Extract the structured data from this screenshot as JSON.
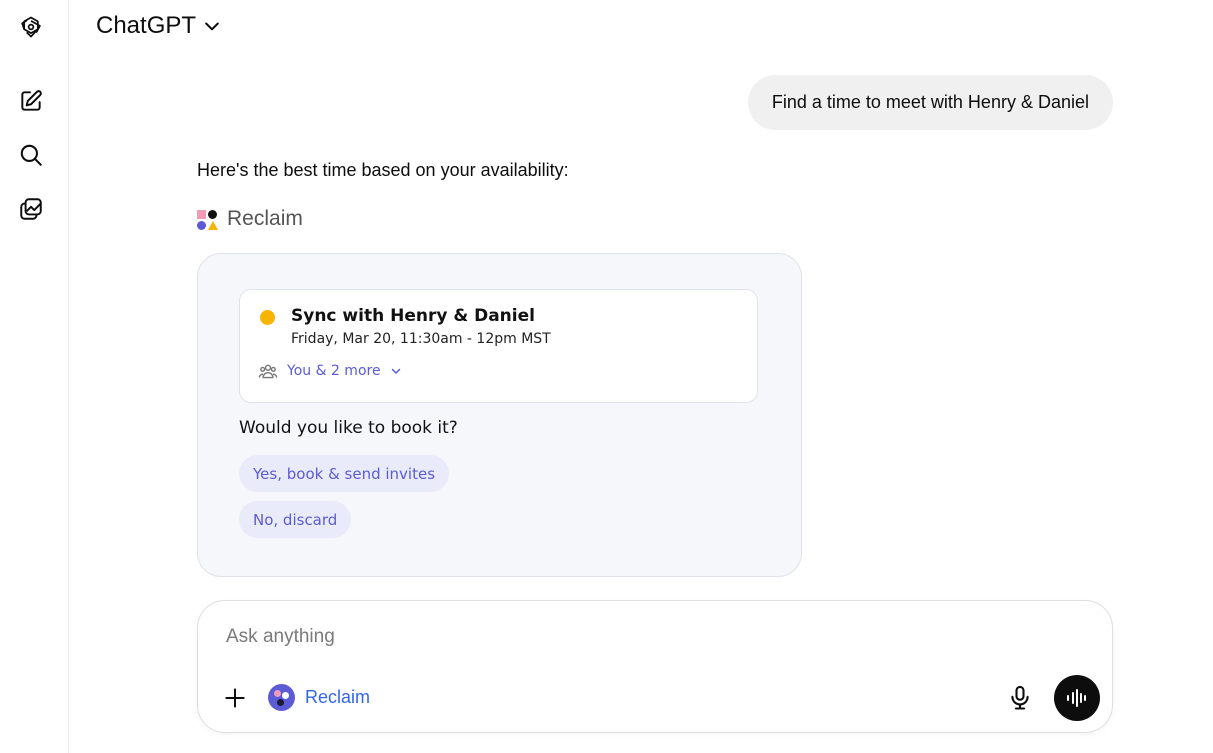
{
  "header": {
    "title": "ChatGPT"
  },
  "sidebar": {
    "items": [
      {
        "icon": "openai-logo-icon"
      },
      {
        "icon": "new-chat-icon"
      },
      {
        "icon": "search-icon"
      },
      {
        "icon": "library-icon"
      }
    ]
  },
  "conversation": {
    "user_message": "Find a time to meet with Henry & Daniel",
    "assistant_intro": "Here's the best time based on your availability:",
    "app_name": "Reclaim"
  },
  "widget": {
    "event": {
      "title": "Sync with Henry & Daniel",
      "time": "Friday, Mar 20, 11:30am - 12pm MST",
      "attendees": "You & 2 more",
      "dot_color": "#f7b500"
    },
    "question": "Would you like to book it?",
    "actions": {
      "confirm": "Yes, book & send invites",
      "discard": "No, discard"
    },
    "accent_color": "#5b5bd6"
  },
  "composer": {
    "placeholder": "Ask anything",
    "tool_label": "Reclaim"
  }
}
